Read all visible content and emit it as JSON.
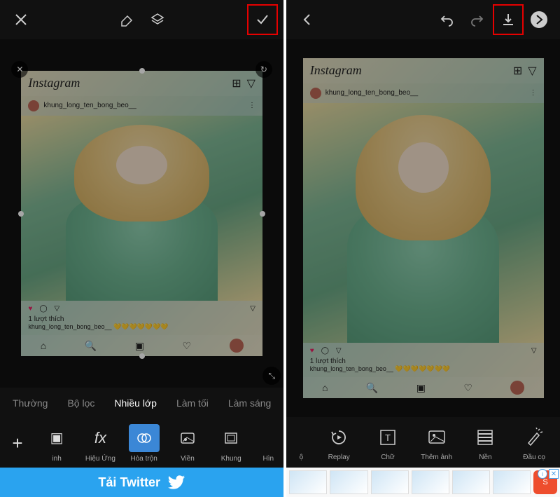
{
  "left": {
    "tabs": {
      "t0": "Thường",
      "t1": "Bộ lọc",
      "t2": "Nhiều lớp",
      "t3": "Làm tối",
      "t4": "Làm sáng"
    },
    "tools": {
      "t0": "inh",
      "t1": "Hiệu Ứng",
      "t2": "Hòa trộn",
      "t3": "Viền",
      "t4": "Khung",
      "t5": "Hìn"
    },
    "ad": "Tải Twitter"
  },
  "right": {
    "tools": {
      "t0": "ộ",
      "t1": "Replay",
      "t2": "Chữ",
      "t3": "Thêm ảnh",
      "t4": "Nền",
      "t5": "Đầu cọ"
    }
  },
  "ig": {
    "logo": "Instagram",
    "username": "khung_long_ten_bong_beo__",
    "likes": "1 lượt thích",
    "hearts": "💛💛💛💛💛💛💛"
  }
}
